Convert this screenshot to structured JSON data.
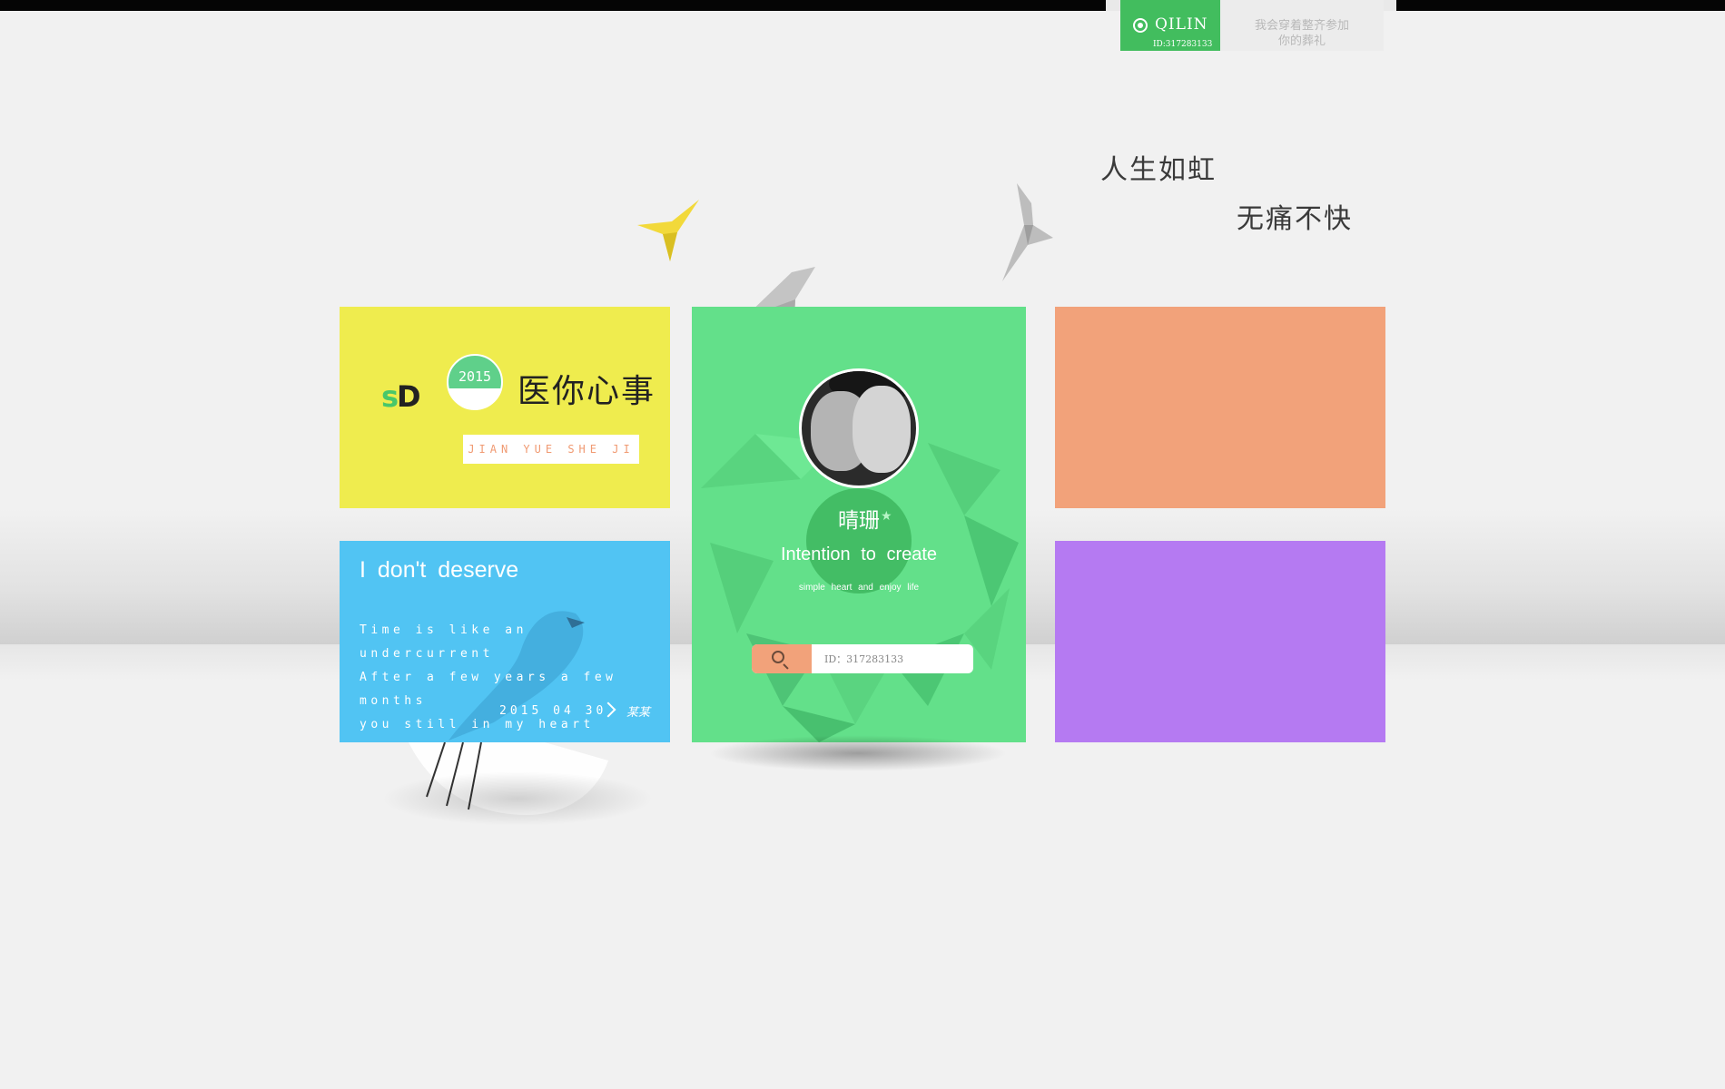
{
  "header": {
    "user_name": "QILIN",
    "user_id": "ID:317283133",
    "quote_line1": "我会穿着整齐参加",
    "quote_line2": "你的葬礼"
  },
  "hero": {
    "line1": "人生如虹",
    "line2": "无痛不快"
  },
  "tiles": {
    "yellow": {
      "logo_part1": "s",
      "logo_part2": "D",
      "year": "2015",
      "title": "医你心事",
      "subtitle": "JIAN YUE SHE JI"
    },
    "blue": {
      "title": "I don't deserve",
      "lines": [
        "Time is like an undercurrent",
        "After a few years a few months",
        "you still in my heart"
      ],
      "date": "2015 04 30",
      "signature": "某某"
    },
    "green": {
      "name": "晴珊",
      "title": "Intention to create",
      "subtitle": "simple heart and enjoy life",
      "search_placeholder": "ID：317283133"
    }
  },
  "colors": {
    "yellow": "#efec4e",
    "green": "#63e08a",
    "orange": "#f2a27a",
    "blue": "#51c4f3",
    "purple": "#b57af2",
    "accent_green": "#42bd5e"
  }
}
